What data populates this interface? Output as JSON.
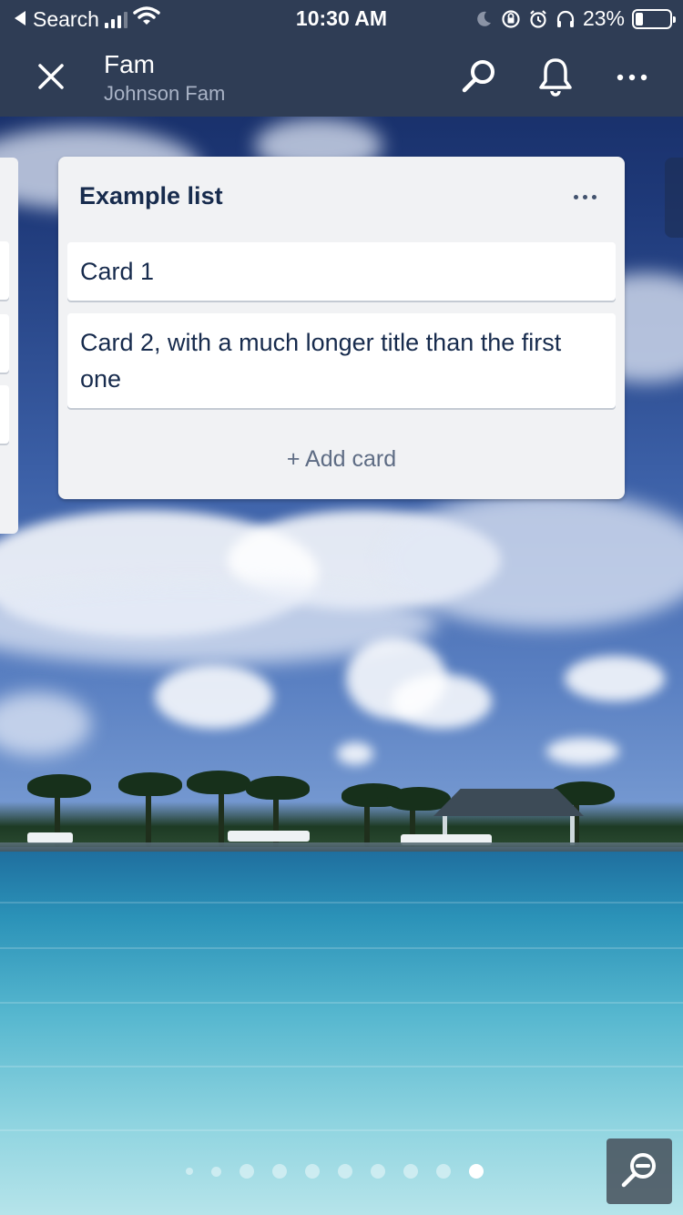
{
  "status_bar": {
    "back_label": "Search",
    "time": "10:30 AM",
    "battery_percent": "23%",
    "icons": [
      "back-arrow-icon",
      "cellular-signal-icon",
      "wifi-icon",
      "moon-icon",
      "orientation-lock-icon",
      "alarm-icon",
      "headphones-icon",
      "battery-icon"
    ]
  },
  "header": {
    "board_title": "Fam",
    "team_name": "Johnson Fam",
    "icons": [
      "close-icon",
      "search-icon",
      "bell-icon",
      "more-icon"
    ]
  },
  "list": {
    "title": "Example list",
    "cards": [
      {
        "title": "Card 1"
      },
      {
        "title": "Card 2, with a much longer title than the first one"
      }
    ],
    "add_card_label": "+ Add card"
  },
  "pager": {
    "count": 10,
    "active_index": 9
  },
  "zoom": {
    "icon": "zoom-out-icon"
  }
}
